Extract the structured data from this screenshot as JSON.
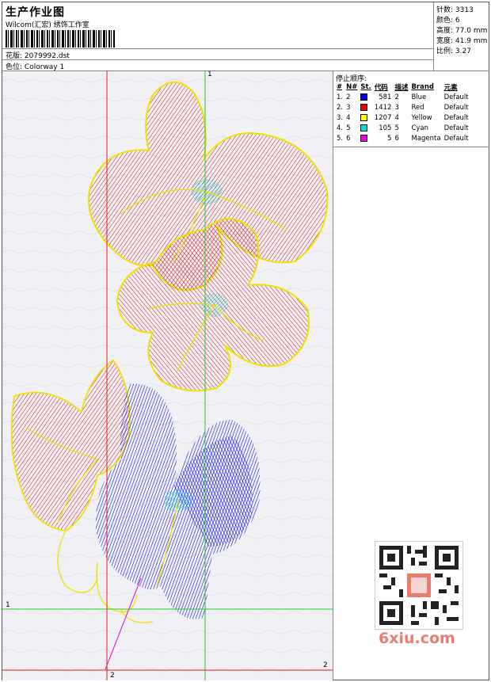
{
  "header": {
    "title": "生产作业图",
    "company": "Wilcom(汇宏) 绣饰工作室",
    "file_label": "花版:",
    "file_value": "2079992.dst",
    "colorway_label": "色位:",
    "colorway_value": "Colorway 1"
  },
  "stats": [
    {
      "label": "针数:",
      "value": "3313"
    },
    {
      "label": "颜色:",
      "value": "6"
    },
    {
      "label": "高度:",
      "value": "77.0 mm"
    },
    {
      "label": "宽度:",
      "value": "41.9 mm"
    },
    {
      "label": "比例:",
      "value": "3.27"
    }
  ],
  "stop_sequence": {
    "title": "停止顺序:",
    "columns": [
      "#",
      "N#",
      "St.",
      "代码",
      "描述",
      "Brand",
      "元素"
    ],
    "rows": [
      {
        "idx": "1.",
        "n": "2",
        "color": "#0000ee",
        "st": "581",
        "code": "2",
        "desc": "Blue",
        "brand": "Default"
      },
      {
        "idx": "2.",
        "n": "3",
        "color": "#ee0000",
        "st": "1412",
        "code": "3",
        "desc": "Red",
        "brand": "Default"
      },
      {
        "idx": "3.",
        "n": "4",
        "color": "#ffff00",
        "st": "1207",
        "code": "4",
        "desc": "Yellow",
        "brand": "Default"
      },
      {
        "idx": "4.",
        "n": "5",
        "color": "#00e0e0",
        "st": "105",
        "code": "5",
        "desc": "Cyan",
        "brand": "Default"
      },
      {
        "idx": "5.",
        "n": "6",
        "color": "#ee00ee",
        "st": "5",
        "code": "6",
        "desc": "Magenta",
        "brand": "Default"
      }
    ]
  },
  "guides": {
    "v_green": "1",
    "h_green": "1",
    "v_red": "2",
    "h_red": "2"
  },
  "watermark": "6xiu.com",
  "colors": {
    "red": "#dd1111",
    "blue": "#0000dd",
    "yellow": "#f5e600",
    "cyan": "#00d8e0",
    "green": "#22cc22",
    "guide_red": "#dd2222"
  }
}
